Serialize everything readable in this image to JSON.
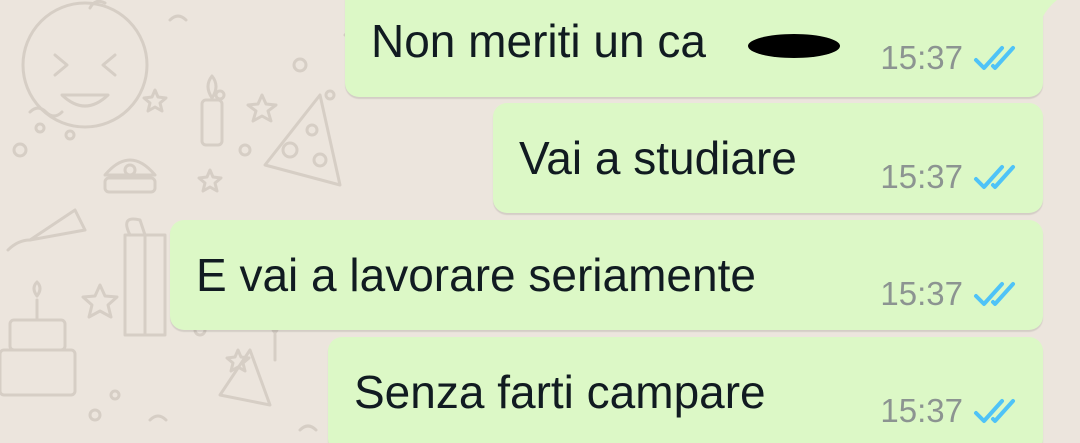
{
  "chat": {
    "messages": [
      {
        "text": "Non meriti un ca",
        "time": "15:37",
        "status": "read",
        "redacted_suffix": true
      },
      {
        "text": "Vai a studiare",
        "time": "15:37",
        "status": "read"
      },
      {
        "text": "E vai a lavorare seriamente",
        "time": "15:37",
        "status": "read"
      },
      {
        "text": "Senza farti campare",
        "time": "15:37",
        "status": "read"
      }
    ]
  },
  "colors": {
    "wallpaper": "#ece5dd",
    "outgoing_bubble": "#dcf8c6",
    "read_ticks": "#4fc3f7",
    "timestamp": "#8c9491"
  },
  "icons": {
    "status": "double-check-read-icon"
  }
}
